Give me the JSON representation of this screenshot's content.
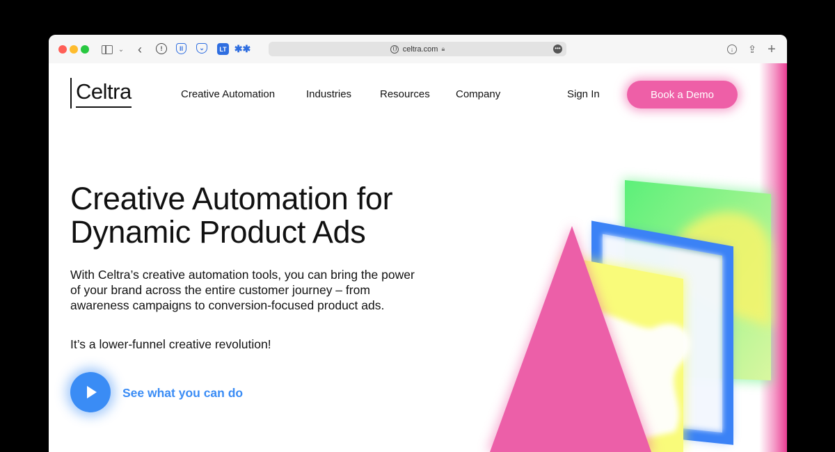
{
  "browser": {
    "url": "celtra.com"
  },
  "header": {
    "logo": "Celtra",
    "nav": [
      "Creative Automation",
      "Industries",
      "Resources",
      "Company"
    ],
    "sign_in": "Sign In",
    "cta": "Book a Demo"
  },
  "hero": {
    "headline_line1": "Creative Automation for",
    "headline_line2": "Dynamic Product Ads",
    "body": "With Celtra’s creative automation tools, you can bring the power of your brand across the entire customer journey – from awareness campaigns to conversion-focused product ads.",
    "tagline": "It’s a lower-funnel creative revolution!",
    "video_link": "See what you can do"
  },
  "colors": {
    "brand_pink": "#ee5fa7",
    "link_blue": "#3a8cf5"
  },
  "icons": {
    "sidebar": "sidebar-icon",
    "back": "back-icon",
    "download": "download-icon",
    "share": "share-icon",
    "new_tab": "plus-icon",
    "play": "play-icon"
  }
}
